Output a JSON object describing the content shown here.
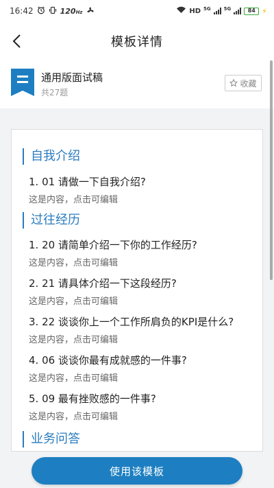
{
  "status_bar": {
    "time": "16:42",
    "refresh_rate": "120",
    "refresh_unit": "Hz",
    "hd_label": "HD",
    "signal1_label": "5G",
    "signal2_label": "5G",
    "battery": "84"
  },
  "nav": {
    "title": "模板详情"
  },
  "template": {
    "name": "通用版面试稿",
    "count": "共27题",
    "favorite_label": "收藏"
  },
  "sections": [
    {
      "title": "自我介绍"
    },
    {
      "title": "过往经历"
    },
    {
      "title": "业务问答"
    }
  ],
  "questions": [
    {
      "title": "1. 01 请做一下自我介绍?",
      "hint": "这是内容，点击可编辑"
    },
    {
      "title": "1. 20 请简单介绍一下你的工作经历?",
      "hint": "这是内容，点击可编辑"
    },
    {
      "title": "2. 21 请具体介绍一下这段经历?",
      "hint": "这是内容，点击可编辑"
    },
    {
      "title": "3. 22 谈谈你上一个工作所肩负的KPI是什么?",
      "hint": "这是内容，点击可编辑"
    },
    {
      "title": "4. 06 谈谈你最有成就感的一件事?",
      "hint": "这是内容，点击可编辑"
    },
    {
      "title": "5. 09 最有挫败感的一件事?",
      "hint": "这是内容，点击可编辑"
    }
  ],
  "footer": {
    "use_template_label": "使用该模板"
  },
  "colors": {
    "accent": "#1d7fc1",
    "section_accent": "#2a7bbf"
  }
}
